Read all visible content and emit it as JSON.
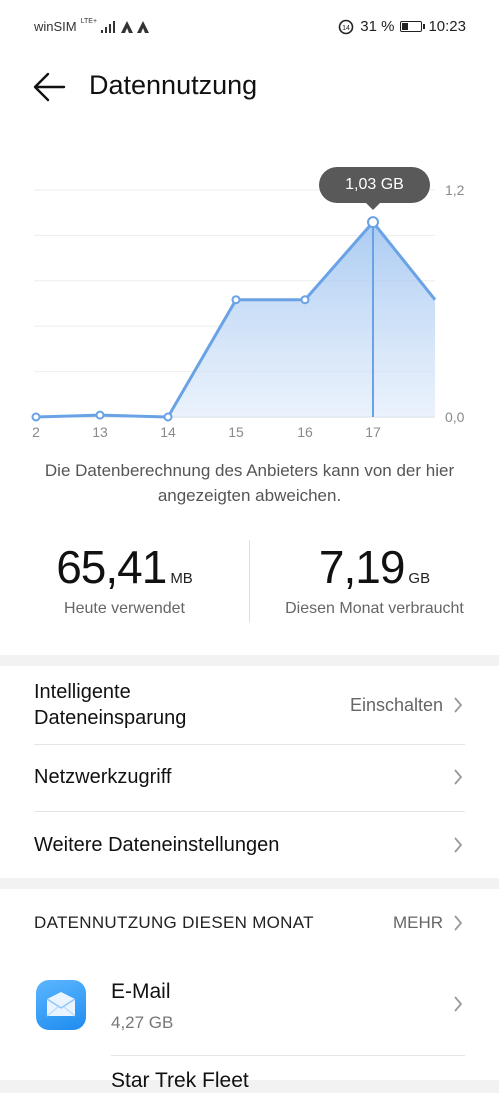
{
  "status_bar": {
    "carrier": "winSIM",
    "network": "LTE+",
    "battery_percent": "31 %",
    "time": "10:23"
  },
  "header": {
    "title": "Datennutzung"
  },
  "chart_data": {
    "type": "area",
    "x": [
      "2",
      "13",
      "14",
      "15",
      "16",
      "17"
    ],
    "values": [
      0.0,
      0.01,
      0.0,
      0.62,
      0.62,
      1.03,
      0.62
    ],
    "yticks": [
      "1,2",
      "0,0"
    ],
    "ylim": [
      0,
      1.2
    ],
    "highlight": {
      "x": "17",
      "label": "1,03 GB"
    },
    "color": "#6aa2e6"
  },
  "disclaimer": "Die Datenberechnung des Anbieters kann von der hier angezeigten abweichen.",
  "stats": {
    "today": {
      "value": "65,41",
      "unit": "MB",
      "label": "Heute verwendet"
    },
    "month": {
      "value": "7,19",
      "unit": "GB",
      "label": "Diesen Monat verbraucht"
    }
  },
  "settings": {
    "smart_saver": {
      "label_line1": "Intelligente",
      "label_line2": "Dateneinsparung",
      "value": "Einschalten"
    },
    "network_access": {
      "label": "Netzwerkzugriff"
    },
    "more_settings": {
      "label": "Weitere Dateneinstellungen"
    }
  },
  "usage": {
    "section_title": "DATENNUTZUNG DIESEN MONAT",
    "more_label": "MEHR",
    "apps": [
      {
        "name": "E-Mail",
        "usage": "4,27 GB",
        "icon": "mail-app-icon"
      },
      {
        "name": "Star Trek Fleet",
        "usage": "",
        "icon": "game-app-icon"
      }
    ]
  }
}
